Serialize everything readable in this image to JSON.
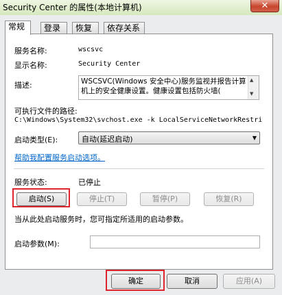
{
  "window": {
    "title": "Security Center 的属性(本地计算机)",
    "close_glyph": "✕"
  },
  "tabs": [
    {
      "label": "常规",
      "active": true
    },
    {
      "label": "登录"
    },
    {
      "label": "恢复"
    },
    {
      "label": "依存关系"
    }
  ],
  "general": {
    "service_name_label": "服务名称:",
    "service_name_value": "wscsvc",
    "display_name_label": "显示名称:",
    "display_name_value": "Security Center",
    "description_label": "描述:",
    "description_value": "WSCSVC(Windows 安全中心)服务监视并报告计算机上的安全健康设置。健康设置包括防火墙(",
    "exe_path_label": "可执行文件的路径:",
    "exe_path_value": "C:\\Windows\\System32\\svchost.exe -k LocalServiceNetworkRestri",
    "startup_type_label": "启动类型(E):",
    "startup_type_value": "自动(延迟启动)",
    "help_link": "帮助我配置服务启动选项。",
    "service_status_label": "服务状态:",
    "service_status_value": "已停止",
    "start_button": "启动(S)",
    "stop_button": "停止(T)",
    "pause_button": "暂停(P)",
    "resume_button": "恢复(R)",
    "hint_text": "当从此处启动服务时，您可指定所适用的启动参数。",
    "start_params_label": "启动参数(M):",
    "start_params_value": ""
  },
  "footer": {
    "ok_button": "确定",
    "cancel_button": "取消",
    "apply_button": "应用(A)"
  },
  "colors": {
    "highlight": "#e0242d",
    "link": "#0066cc"
  }
}
